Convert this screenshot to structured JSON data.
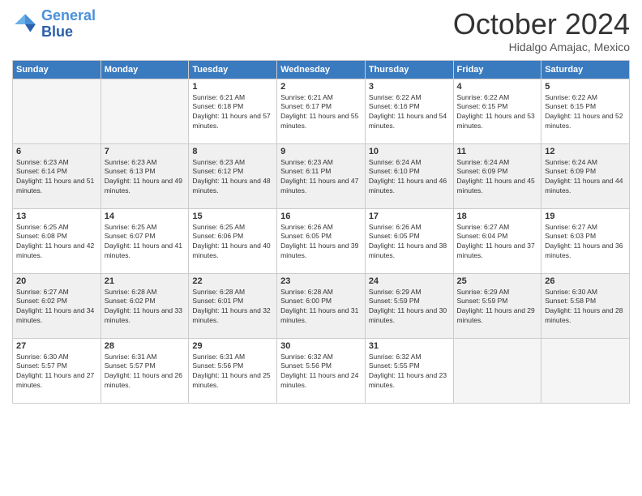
{
  "header": {
    "logo_line1": "General",
    "logo_line2": "Blue",
    "month": "October 2024",
    "location": "Hidalgo Amajac, Mexico"
  },
  "weekdays": [
    "Sunday",
    "Monday",
    "Tuesday",
    "Wednesday",
    "Thursday",
    "Friday",
    "Saturday"
  ],
  "weeks": [
    [
      {
        "day": "",
        "info": ""
      },
      {
        "day": "",
        "info": ""
      },
      {
        "day": "1",
        "info": "Sunrise: 6:21 AM\nSunset: 6:18 PM\nDaylight: 11 hours and 57 minutes."
      },
      {
        "day": "2",
        "info": "Sunrise: 6:21 AM\nSunset: 6:17 PM\nDaylight: 11 hours and 55 minutes."
      },
      {
        "day": "3",
        "info": "Sunrise: 6:22 AM\nSunset: 6:16 PM\nDaylight: 11 hours and 54 minutes."
      },
      {
        "day": "4",
        "info": "Sunrise: 6:22 AM\nSunset: 6:15 PM\nDaylight: 11 hours and 53 minutes."
      },
      {
        "day": "5",
        "info": "Sunrise: 6:22 AM\nSunset: 6:15 PM\nDaylight: 11 hours and 52 minutes."
      }
    ],
    [
      {
        "day": "6",
        "info": "Sunrise: 6:23 AM\nSunset: 6:14 PM\nDaylight: 11 hours and 51 minutes."
      },
      {
        "day": "7",
        "info": "Sunrise: 6:23 AM\nSunset: 6:13 PM\nDaylight: 11 hours and 49 minutes."
      },
      {
        "day": "8",
        "info": "Sunrise: 6:23 AM\nSunset: 6:12 PM\nDaylight: 11 hours and 48 minutes."
      },
      {
        "day": "9",
        "info": "Sunrise: 6:23 AM\nSunset: 6:11 PM\nDaylight: 11 hours and 47 minutes."
      },
      {
        "day": "10",
        "info": "Sunrise: 6:24 AM\nSunset: 6:10 PM\nDaylight: 11 hours and 46 minutes."
      },
      {
        "day": "11",
        "info": "Sunrise: 6:24 AM\nSunset: 6:09 PM\nDaylight: 11 hours and 45 minutes."
      },
      {
        "day": "12",
        "info": "Sunrise: 6:24 AM\nSunset: 6:09 PM\nDaylight: 11 hours and 44 minutes."
      }
    ],
    [
      {
        "day": "13",
        "info": "Sunrise: 6:25 AM\nSunset: 6:08 PM\nDaylight: 11 hours and 42 minutes."
      },
      {
        "day": "14",
        "info": "Sunrise: 6:25 AM\nSunset: 6:07 PM\nDaylight: 11 hours and 41 minutes."
      },
      {
        "day": "15",
        "info": "Sunrise: 6:25 AM\nSunset: 6:06 PM\nDaylight: 11 hours and 40 minutes."
      },
      {
        "day": "16",
        "info": "Sunrise: 6:26 AM\nSunset: 6:05 PM\nDaylight: 11 hours and 39 minutes."
      },
      {
        "day": "17",
        "info": "Sunrise: 6:26 AM\nSunset: 6:05 PM\nDaylight: 11 hours and 38 minutes."
      },
      {
        "day": "18",
        "info": "Sunrise: 6:27 AM\nSunset: 6:04 PM\nDaylight: 11 hours and 37 minutes."
      },
      {
        "day": "19",
        "info": "Sunrise: 6:27 AM\nSunset: 6:03 PM\nDaylight: 11 hours and 36 minutes."
      }
    ],
    [
      {
        "day": "20",
        "info": "Sunrise: 6:27 AM\nSunset: 6:02 PM\nDaylight: 11 hours and 34 minutes."
      },
      {
        "day": "21",
        "info": "Sunrise: 6:28 AM\nSunset: 6:02 PM\nDaylight: 11 hours and 33 minutes."
      },
      {
        "day": "22",
        "info": "Sunrise: 6:28 AM\nSunset: 6:01 PM\nDaylight: 11 hours and 32 minutes."
      },
      {
        "day": "23",
        "info": "Sunrise: 6:28 AM\nSunset: 6:00 PM\nDaylight: 11 hours and 31 minutes."
      },
      {
        "day": "24",
        "info": "Sunrise: 6:29 AM\nSunset: 5:59 PM\nDaylight: 11 hours and 30 minutes."
      },
      {
        "day": "25",
        "info": "Sunrise: 6:29 AM\nSunset: 5:59 PM\nDaylight: 11 hours and 29 minutes."
      },
      {
        "day": "26",
        "info": "Sunrise: 6:30 AM\nSunset: 5:58 PM\nDaylight: 11 hours and 28 minutes."
      }
    ],
    [
      {
        "day": "27",
        "info": "Sunrise: 6:30 AM\nSunset: 5:57 PM\nDaylight: 11 hours and 27 minutes."
      },
      {
        "day": "28",
        "info": "Sunrise: 6:31 AM\nSunset: 5:57 PM\nDaylight: 11 hours and 26 minutes."
      },
      {
        "day": "29",
        "info": "Sunrise: 6:31 AM\nSunset: 5:56 PM\nDaylight: 11 hours and 25 minutes."
      },
      {
        "day": "30",
        "info": "Sunrise: 6:32 AM\nSunset: 5:56 PM\nDaylight: 11 hours and 24 minutes."
      },
      {
        "day": "31",
        "info": "Sunrise: 6:32 AM\nSunset: 5:55 PM\nDaylight: 11 hours and 23 minutes."
      },
      {
        "day": "",
        "info": ""
      },
      {
        "day": "",
        "info": ""
      }
    ]
  ]
}
